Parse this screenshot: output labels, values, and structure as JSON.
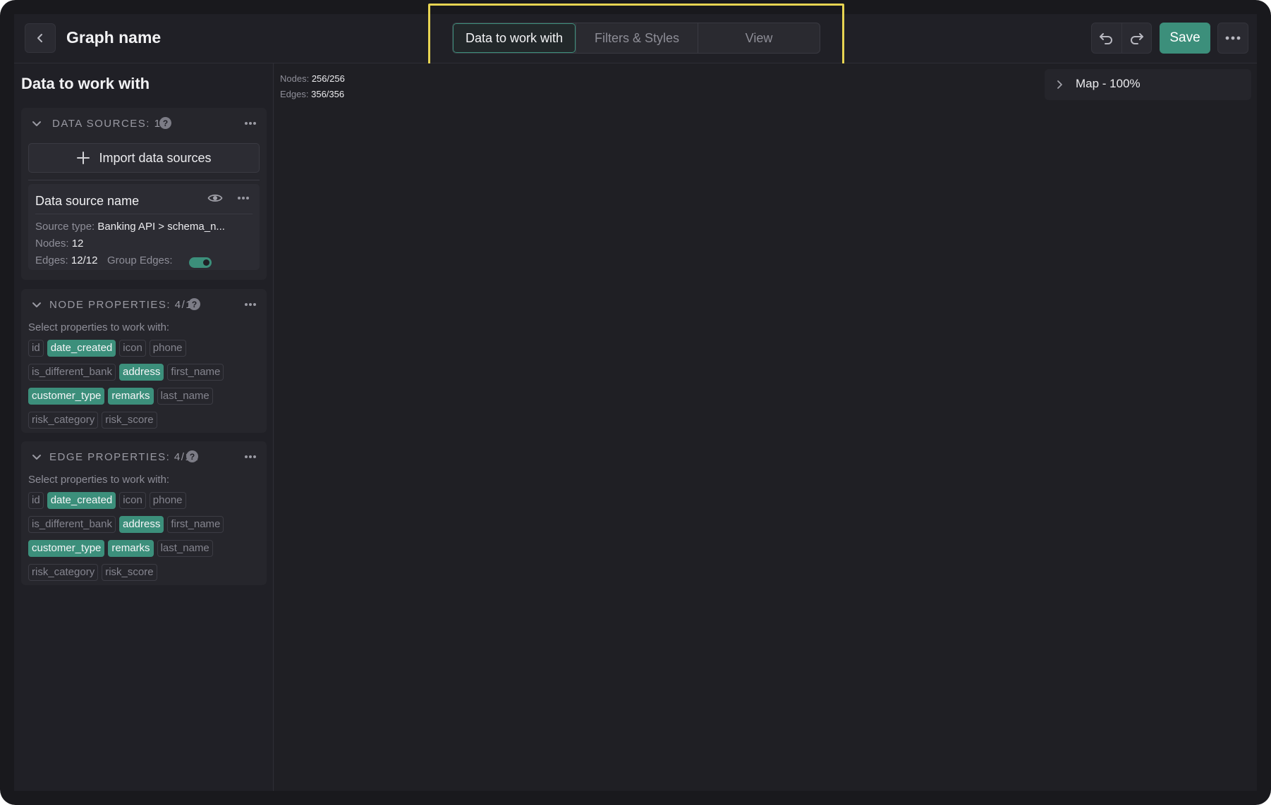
{
  "header": {
    "title": "Graph name",
    "tabs": [
      {
        "label": "Data to work with",
        "active": true
      },
      {
        "label": "Filters & Styles",
        "active": false
      },
      {
        "label": "View",
        "active": false
      }
    ],
    "save_label": "Save"
  },
  "sidebar": {
    "title": "Data to work with",
    "data_sources": {
      "label": "DATA SOURCES: 1",
      "import_label": "Import data sources",
      "card": {
        "name": "Data source name",
        "source_type_label": "Source type:",
        "source_type_value": "Banking API > schema_n...",
        "nodes_label": "Nodes:",
        "nodes_value": "12",
        "edges_label": "Edges:",
        "edges_value": "12/12",
        "group_edges_label": "Group Edges:",
        "group_edges_on": true
      }
    },
    "node_properties": {
      "label": "NODE PROPERTIES: 4/12",
      "hint": "Select properties to work with:",
      "rows": [
        [
          {
            "label": "id",
            "on": false
          },
          {
            "label": "date_created",
            "on": true
          },
          {
            "label": "icon",
            "on": false
          },
          {
            "label": "phone",
            "on": false
          }
        ],
        [
          {
            "label": "is_different_bank",
            "on": false
          },
          {
            "label": "address",
            "on": true
          },
          {
            "label": "first_name",
            "on": false
          }
        ],
        [
          {
            "label": "customer_type",
            "on": true
          },
          {
            "label": "remarks",
            "on": true
          },
          {
            "label": "last_name",
            "on": false
          }
        ],
        [
          {
            "label": "risk_category",
            "on": false
          },
          {
            "label": "risk_score",
            "on": false
          }
        ]
      ]
    },
    "edge_properties": {
      "label": "EDGE PROPERTIES: 4/12",
      "hint": "Select properties to work with:",
      "rows": [
        [
          {
            "label": "id",
            "on": false
          },
          {
            "label": "date_created",
            "on": true
          },
          {
            "label": "icon",
            "on": false
          },
          {
            "label": "phone",
            "on": false
          }
        ],
        [
          {
            "label": "is_different_bank",
            "on": false
          },
          {
            "label": "address",
            "on": true
          },
          {
            "label": "first_name",
            "on": false
          }
        ],
        [
          {
            "label": "customer_type",
            "on": true
          },
          {
            "label": "remarks",
            "on": true
          },
          {
            "label": "last_name",
            "on": false
          }
        ],
        [
          {
            "label": "risk_category",
            "on": false
          },
          {
            "label": "risk_score",
            "on": false
          }
        ]
      ]
    }
  },
  "canvas": {
    "nodes_label": "Nodes:",
    "nodes_value": "256/256",
    "edges_label": "Edges:",
    "edges_value": "356/356",
    "map_label": "Map - 100%"
  },
  "colors": {
    "accent": "#3c8f7b",
    "highlight": "#e7d452",
    "background": "#202026"
  }
}
